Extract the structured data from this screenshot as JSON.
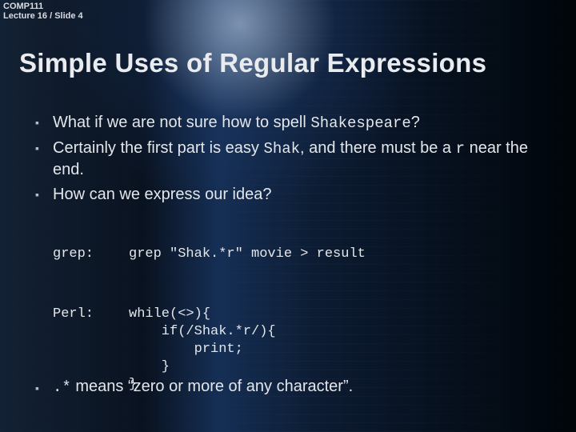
{
  "header": {
    "course": "COMP111",
    "lecture": "Lecture 16 / Slide 4"
  },
  "title": "Simple Uses of Regular Expressions",
  "bullets": {
    "b1_pre": "What if we are not sure how to spell ",
    "b1_code": "Shakespeare",
    "b1_post": "?",
    "b2_pre": "Certainly the first part is easy ",
    "b2_code1": "Shak",
    "b2_mid": ", and there must be a ",
    "b2_code2": "r",
    "b2_post": " near the end.",
    "b3": "How can we express our idea?"
  },
  "examples": {
    "grep_label": "grep:",
    "grep_code": "grep \"Shak.*r\" movie > result",
    "perl_label": "Perl:",
    "perl_code": "while(<>){\n    if(/Shak.*r/){\n        print;\n    }\n}"
  },
  "footer": {
    "code": ".*",
    "text": " means “zero or more of any character”."
  }
}
